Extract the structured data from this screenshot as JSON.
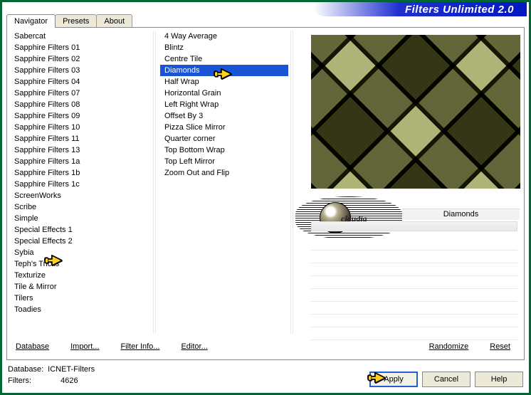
{
  "title": "Filters Unlimited 2.0",
  "tabs": [
    {
      "label": "Navigator",
      "active": true
    },
    {
      "label": "Presets",
      "active": false
    },
    {
      "label": "About",
      "active": false
    }
  ],
  "categories": {
    "items": [
      "Sabercat",
      "Sapphire Filters 01",
      "Sapphire Filters 02",
      "Sapphire Filters 03",
      "Sapphire Filters 04",
      "Sapphire Filters 07",
      "Sapphire Filters 08",
      "Sapphire Filters 09",
      "Sapphire Filters 10",
      "Sapphire Filters 11",
      "Sapphire Filters 13",
      "Sapphire Filters 1a",
      "Sapphire Filters 1b",
      "Sapphire Filters 1c",
      "ScreenWorks",
      "Scribe",
      "Simple",
      "Special Effects 1",
      "Special Effects 2",
      "Sybia",
      "Teph's Tricks",
      "Texturize",
      "Tile & Mirror",
      "Tilers",
      "Toadies"
    ],
    "selected_index": 16
  },
  "effects": {
    "items": [
      "4 Way Average",
      "Blintz",
      "Centre Tile",
      "Diamonds",
      "Half Wrap",
      "Horizontal Grain",
      "Left Right Wrap",
      "Offset By 3",
      "Pizza Slice Mirror",
      "Quarter corner",
      "Top Bottom Wrap",
      "Top Left Mirror",
      "Zoom Out and Flip"
    ],
    "selected_index": 3
  },
  "current_effect_name": "Diamonds",
  "watermark_text": "claudia",
  "link_buttons": {
    "database": "Database",
    "import": "Import...",
    "filterinfo": "Filter Info...",
    "editor": "Editor...",
    "randomize": "Randomize",
    "reset": "Reset"
  },
  "status": {
    "db_label": "Database:",
    "db_value": "ICNET-Filters",
    "filters_label": "Filters:",
    "filters_value": "4626"
  },
  "buttons": {
    "apply": "Apply",
    "cancel": "Cancel",
    "help": "Help"
  }
}
